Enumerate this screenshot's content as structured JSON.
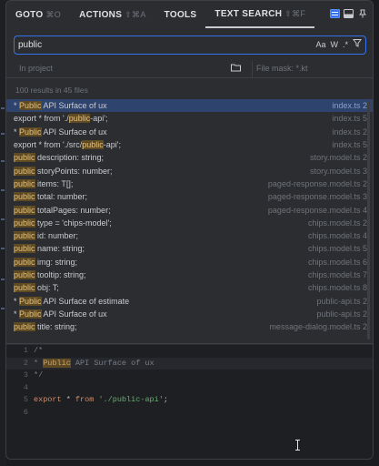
{
  "tabs": [
    {
      "label": "GOTO",
      "shortcut": "⌘O"
    },
    {
      "label": "ACTIONS",
      "shortcut": "⇧⌘A"
    },
    {
      "label": "TOOLS",
      "shortcut": ""
    },
    {
      "label": "TEXT SEARCH",
      "shortcut": "⇧⌘F"
    }
  ],
  "search": {
    "value": "public",
    "options": [
      "Aa",
      "W",
      ".*"
    ]
  },
  "scope": {
    "left": "In project",
    "file_mask": "File mask: *.kt"
  },
  "results_count": "100 results in 45 files",
  "results": [
    {
      "pre": "* ",
      "match": "Public",
      "post": " API Surface of ux",
      "file": "index.ts 2",
      "selected": true
    },
    {
      "pre": "export * from './",
      "match": "public",
      "post": "-api';",
      "file": "index.ts 5"
    },
    {
      "pre": "* ",
      "match": "Public",
      "post": " API Surface of ux",
      "file": "index.ts 2"
    },
    {
      "pre": "export * from './src/",
      "match": "public",
      "post": "-api';",
      "file": "index.ts 5"
    },
    {
      "pre": "",
      "match": "public",
      "post": " description: string;",
      "file": "story.model.ts 2"
    },
    {
      "pre": "",
      "match": "public",
      "post": " storyPoints: number;",
      "file": "story.model.ts 3"
    },
    {
      "pre": "",
      "match": "public",
      "post": " items: T[];",
      "file": "paged-response.model.ts 2"
    },
    {
      "pre": "",
      "match": "public",
      "post": " total: number;",
      "file": "paged-response.model.ts 3"
    },
    {
      "pre": "",
      "match": "public",
      "post": " totalPages: number;",
      "file": "paged-response.model.ts 4"
    },
    {
      "pre": "",
      "match": "public",
      "post": " type = 'chips-model';",
      "file": "chips.model.ts 2"
    },
    {
      "pre": "",
      "match": "public",
      "post": " id: number;",
      "file": "chips.model.ts 4"
    },
    {
      "pre": "",
      "match": "public",
      "post": " name: string;",
      "file": "chips.model.ts 5"
    },
    {
      "pre": "",
      "match": "public",
      "post": " img: string;",
      "file": "chips.model.ts 6"
    },
    {
      "pre": "",
      "match": "public",
      "post": " tooltip: string;",
      "file": "chips.model.ts 7"
    },
    {
      "pre": "",
      "match": "public",
      "post": " obj: T;",
      "file": "chips.model.ts 8"
    },
    {
      "pre": "* ",
      "match": "Public",
      "post": " API Surface of estimate",
      "file": "public-api.ts 2"
    },
    {
      "pre": "* ",
      "match": "Public",
      "post": " API Surface of ux",
      "file": "public-api.ts 2"
    },
    {
      "pre": "",
      "match": "public",
      "post": " title: string;",
      "file": "message-dialog.model.ts 2"
    }
  ],
  "preview": {
    "lines": [
      {
        "num": "1",
        "text": "/*"
      },
      {
        "num": "2",
        "pre": " * ",
        "match": "Public",
        "post": " API Surface of ux"
      },
      {
        "num": "3",
        "text": " */"
      },
      {
        "num": "4",
        "text": ""
      },
      {
        "num": "5",
        "kw": "export",
        "mid": " * ",
        "kw2": "from",
        "str": "'./public-api'",
        "end": ";"
      },
      {
        "num": "6",
        "text": ""
      }
    ]
  }
}
